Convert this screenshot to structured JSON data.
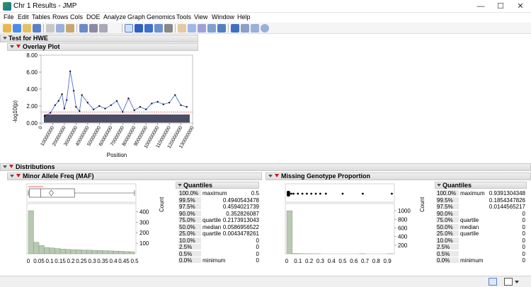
{
  "window": {
    "title": "Chr 1 Results - JMP",
    "minimize": "—",
    "maximize": "☐",
    "close": "✕"
  },
  "menu": [
    "File",
    "Edit",
    "Tables",
    "Rows",
    "Cols",
    "DOE",
    "Analyze",
    "Graph",
    "Genomics",
    "Tools",
    "View",
    "Window",
    "Help"
  ],
  "report": {
    "title": "Test for HWE",
    "overlay": {
      "title": "Overlay Plot",
      "ylabel": "-log10(p)",
      "xlabel": "Position",
      "yticks": [
        "0.00",
        "2.00",
        "4.00",
        "6.00",
        "8.00"
      ],
      "xticks": [
        "0",
        "10000000",
        "20000000",
        "30000000",
        "40000000",
        "50000000",
        "60000000",
        "70000000",
        "80000000",
        "90000000",
        "100000000",
        "110000000",
        "120000000",
        "130000000"
      ]
    },
    "distributions": {
      "title": "Distributions",
      "maf": {
        "title": "Minor Allele Freq (MAF)",
        "xticks": [
          "0",
          "0.05",
          "0.1",
          "0.15",
          "0.2",
          "0.25",
          "0.3",
          "0.35",
          "0.4",
          "0.45",
          "0.5"
        ],
        "count_ticks": [
          "400",
          "300",
          "200",
          "100"
        ],
        "count_label": "Count",
        "quantiles_title": "Quantiles",
        "quantiles": [
          {
            "pct": "100.0%",
            "label": "maximum",
            "value": "0.5"
          },
          {
            "pct": "99.5%",
            "label": "",
            "value": "0.4940543478"
          },
          {
            "pct": "97.5%",
            "label": "",
            "value": "0.4594021739"
          },
          {
            "pct": "90.0%",
            "label": "",
            "value": "0.352826087"
          },
          {
            "pct": "75.0%",
            "label": "quartile",
            "value": "0.2173913043"
          },
          {
            "pct": "50.0%",
            "label": "median",
            "value": "0.0586956522"
          },
          {
            "pct": "25.0%",
            "label": "quartile",
            "value": "0.0043478261"
          },
          {
            "pct": "10.0%",
            "label": "",
            "value": "0"
          },
          {
            "pct": "2.5%",
            "label": "",
            "value": "0"
          },
          {
            "pct": "0.5%",
            "label": "",
            "value": "0"
          },
          {
            "pct": "0.0%",
            "label": "minimum",
            "value": "0"
          }
        ]
      },
      "missing": {
        "title": "Missing Genotype Proportion",
        "xticks": [
          "0",
          "0.1",
          "0.2",
          "0.3",
          "0.4",
          "0.5",
          "0.6",
          "0.7",
          "0.8",
          "0.9"
        ],
        "count_ticks": [
          "1000",
          "800",
          "600",
          "400",
          "200"
        ],
        "count_label": "Count",
        "quantiles_title": "Quantiles",
        "quantiles": [
          {
            "pct": "100.0%",
            "label": "maximum",
            "value": "0.9391304348"
          },
          {
            "pct": "99.5%",
            "label": "",
            "value": "0.1854347826"
          },
          {
            "pct": "97.5%",
            "label": "",
            "value": "0.0144565217"
          },
          {
            "pct": "90.0%",
            "label": "",
            "value": "0"
          },
          {
            "pct": "75.0%",
            "label": "quartile",
            "value": "0"
          },
          {
            "pct": "50.0%",
            "label": "median",
            "value": "0"
          },
          {
            "pct": "25.0%",
            "label": "quartile",
            "value": "0"
          },
          {
            "pct": "10.0%",
            "label": "",
            "value": "0"
          },
          {
            "pct": "2.5%",
            "label": "",
            "value": "0"
          },
          {
            "pct": "0.5%",
            "label": "",
            "value": "0"
          },
          {
            "pct": "0.0%",
            "label": "minimum",
            "value": "0"
          }
        ]
      }
    }
  },
  "colors": {
    "series": "#3f5fc0",
    "points": "#101030",
    "ref_line": "#e04040",
    "hist": "#b7c9b1",
    "hist_border": "#7f8f7a"
  },
  "chart_data": [
    {
      "type": "scatter",
      "title": "Overlay Plot",
      "xlabel": "Position",
      "ylabel": "-log10(p)",
      "xlim": [
        0,
        130000000
      ],
      "ylim": [
        0,
        8
      ],
      "x": [
        3000000,
        8000000,
        12000000,
        15000000,
        18000000,
        20000000,
        22000000,
        25000000,
        28000000,
        30000000,
        33000000,
        35000000,
        40000000,
        45000000,
        50000000,
        55000000,
        60000000,
        65000000,
        70000000,
        75000000,
        80000000,
        85000000,
        90000000,
        95000000,
        100000000,
        105000000,
        110000000,
        115000000,
        120000000,
        125000000
      ],
      "y": [
        0.8,
        1.2,
        2.1,
        2.6,
        3.4,
        1.7,
        2.7,
        6.1,
        3.8,
        1.9,
        1.4,
        3.3,
        2.4,
        1.6,
        2.0,
        1.7,
        2.1,
        2.6,
        1.3,
        2.9,
        1.5,
        1.9,
        1.6,
        2.3,
        2.5,
        2.2,
        2.4,
        3.3,
        2.1,
        1.9
      ],
      "reference_line": 1.3
    },
    {
      "type": "bar",
      "title": "Minor Allele Freq (MAF)",
      "ylabel": "Count",
      "bin_start": 0,
      "bin_width": 0.025,
      "values": [
        410,
        110,
        80,
        60,
        55,
        50,
        45,
        42,
        40,
        38,
        36,
        35,
        33,
        32,
        30,
        28,
        26,
        24,
        22,
        20
      ],
      "ylim": [
        0,
        450
      ]
    },
    {
      "type": "bar",
      "title": "Missing Genotype Proportion",
      "ylabel": "Count",
      "bin_start": 0,
      "bin_width": 0.05,
      "values": [
        1000,
        8,
        4,
        2,
        1,
        1,
        0,
        0,
        0,
        0,
        0,
        0,
        0,
        1,
        0,
        0,
        0,
        0,
        1
      ],
      "ylim": [
        0,
        1100
      ]
    }
  ]
}
